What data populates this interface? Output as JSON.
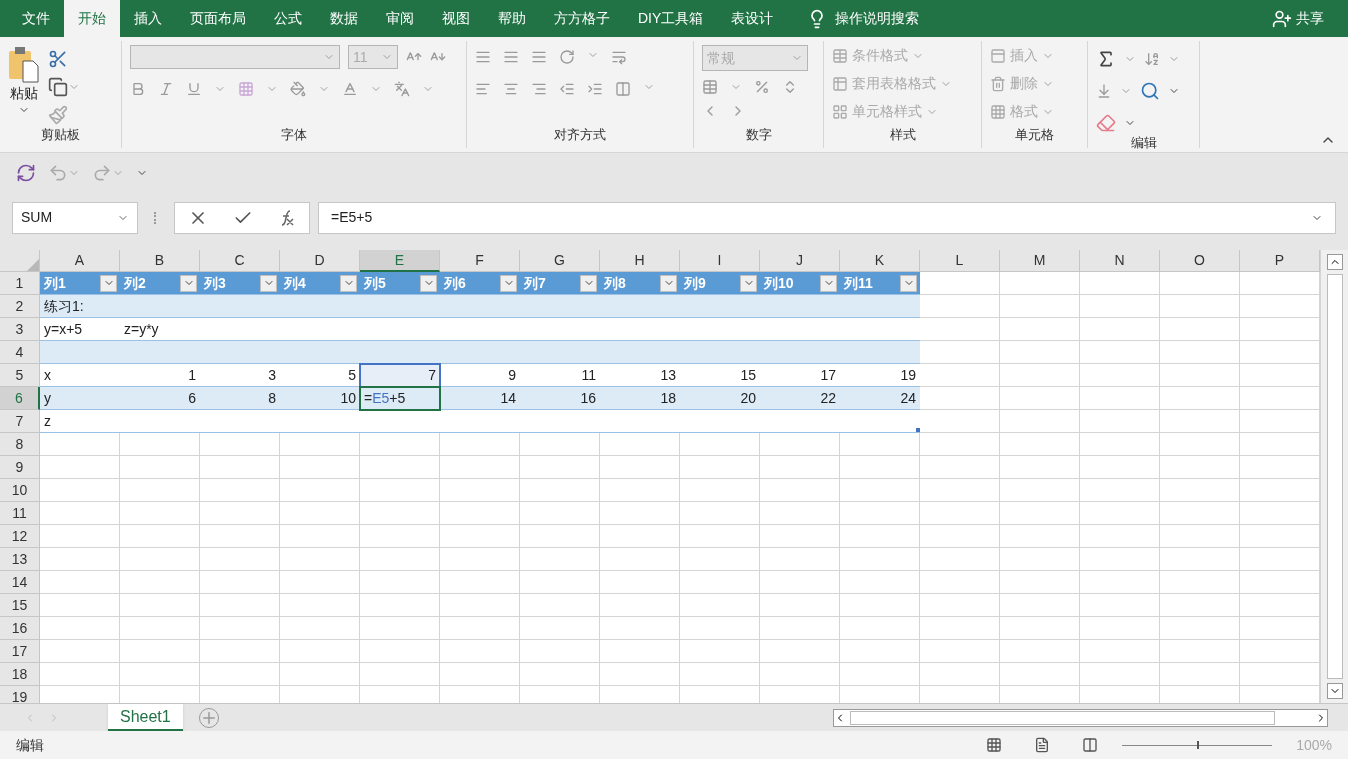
{
  "ribbon_tabs": [
    {
      "label": "文件",
      "selected": false
    },
    {
      "label": "开始",
      "selected": true
    },
    {
      "label": "插入",
      "selected": false
    },
    {
      "label": "页面布局",
      "selected": false
    },
    {
      "label": "公式",
      "selected": false
    },
    {
      "label": "数据",
      "selected": false
    },
    {
      "label": "审阅",
      "selected": false
    },
    {
      "label": "视图",
      "selected": false
    },
    {
      "label": "帮助",
      "selected": false
    },
    {
      "label": "方方格子",
      "selected": false
    },
    {
      "label": "DIY工具箱",
      "selected": false
    },
    {
      "label": "表设计",
      "selected": false
    }
  ],
  "tell_me": "操作说明搜索",
  "share": "共享",
  "ribbon": {
    "clipboard": {
      "label": "剪贴板",
      "paste": "粘贴"
    },
    "font": {
      "label": "字体",
      "size": "11"
    },
    "alignment": {
      "label": "对齐方式"
    },
    "number": {
      "label": "数字",
      "format": "常规"
    },
    "styles": {
      "label": "样式",
      "items": [
        "条件格式",
        "套用表格格式",
        "单元格样式"
      ]
    },
    "cells": {
      "label": "单元格",
      "items": [
        "插入",
        "删除",
        "格式"
      ]
    },
    "editing": {
      "label": "编辑"
    }
  },
  "formula_bar": {
    "name_box": "SUM",
    "formula": "=E5+5"
  },
  "sheet": {
    "columns": [
      {
        "label": "A",
        "selected": false
      },
      {
        "label": "B",
        "selected": false
      },
      {
        "label": "C",
        "selected": false
      },
      {
        "label": "D",
        "selected": false
      },
      {
        "label": "E",
        "selected": true
      },
      {
        "label": "F",
        "selected": false
      },
      {
        "label": "G",
        "selected": false
      },
      {
        "label": "H",
        "selected": false
      },
      {
        "label": "I",
        "selected": false
      },
      {
        "label": "J",
        "selected": false
      },
      {
        "label": "K",
        "selected": false
      },
      {
        "label": "L",
        "selected": false
      },
      {
        "label": "M",
        "selected": false
      },
      {
        "label": "N",
        "selected": false
      },
      {
        "label": "O",
        "selected": false
      },
      {
        "label": "P",
        "selected": false
      }
    ],
    "rows": [
      {
        "number": "1",
        "selected": false,
        "kind": "header",
        "cells": [
          {
            "text": "列1"
          },
          {
            "text": "列2"
          },
          {
            "text": "列3"
          },
          {
            "text": "列4"
          },
          {
            "text": "列5"
          },
          {
            "text": "列6"
          },
          {
            "text": "列7"
          },
          {
            "text": "列8"
          },
          {
            "text": "列9"
          },
          {
            "text": "列10"
          },
          {
            "text": "列11"
          }
        ]
      },
      {
        "number": "2",
        "selected": false,
        "kind": "band",
        "cells": [
          {
            "text": "练习1:",
            "kind": "text"
          }
        ]
      },
      {
        "number": "3",
        "selected": false,
        "kind": "table",
        "cells": [
          {
            "text": "y=x+5",
            "kind": "text"
          },
          {
            "text": "z=y*y",
            "kind": "text"
          }
        ]
      },
      {
        "number": "4",
        "selected": false,
        "kind": "band",
        "cells": []
      },
      {
        "number": "5",
        "selected": false,
        "kind": "table",
        "cells": [
          {
            "text": "x",
            "kind": "text",
            "referenced": false
          },
          {
            "text": "1",
            "kind": "number",
            "referenced": false
          },
          {
            "text": "3",
            "kind": "number",
            "referenced": false
          },
          {
            "text": "5",
            "kind": "number",
            "referenced": false
          },
          {
            "text": "7",
            "kind": "number",
            "referenced": true
          },
          {
            "text": "9",
            "kind": "number",
            "referenced": false
          },
          {
            "text": "11",
            "kind": "number",
            "referenced": false
          },
          {
            "text": "13",
            "kind": "number",
            "referenced": false
          },
          {
            "text": "15",
            "kind": "number",
            "referenced": false
          },
          {
            "text": "17",
            "kind": "number",
            "referenced": false
          },
          {
            "text": "19",
            "kind": "number",
            "referenced": false
          }
        ]
      },
      {
        "number": "6",
        "selected": true,
        "kind": "band",
        "cells": [
          {
            "text": "y",
            "kind": "text"
          },
          {
            "text": "6",
            "kind": "number"
          },
          {
            "text": "8",
            "kind": "number"
          },
          {
            "text": "10",
            "kind": "number"
          },
          {
            "kind": "formula",
            "parts": [
              {
                "text": "=",
                "kind": "plain"
              },
              {
                "text": "E5",
                "kind": "ref"
              },
              {
                "text": "+5",
                "kind": "plain"
              }
            ]
          },
          {
            "text": "14",
            "kind": "number"
          },
          {
            "text": "16",
            "kind": "number"
          },
          {
            "text": "18",
            "kind": "number"
          },
          {
            "text": "20",
            "kind": "number"
          },
          {
            "text": "22",
            "kind": "number"
          },
          {
            "text": "24",
            "kind": "number"
          }
        ]
      },
      {
        "number": "7",
        "selected": false,
        "kind": "table",
        "cells": [
          {
            "text": "z",
            "kind": "text"
          }
        ]
      },
      {
        "number": "8",
        "selected": false,
        "kind": "plain",
        "cells": []
      },
      {
        "number": "9",
        "selected": false,
        "kind": "plain",
        "cells": []
      },
      {
        "number": "10",
        "selected": false,
        "kind": "plain",
        "cells": []
      },
      {
        "number": "11",
        "selected": false,
        "kind": "plain",
        "cells": []
      },
      {
        "number": "12",
        "selected": false,
        "kind": "plain",
        "cells": []
      },
      {
        "number": "13",
        "selected": false,
        "kind": "plain",
        "cells": []
      },
      {
        "number": "14",
        "selected": false,
        "kind": "plain",
        "cells": []
      },
      {
        "number": "15",
        "selected": false,
        "kind": "plain",
        "cells": []
      },
      {
        "number": "16",
        "selected": false,
        "kind": "plain",
        "cells": []
      },
      {
        "number": "17",
        "selected": false,
        "kind": "plain",
        "cells": []
      },
      {
        "number": "18",
        "selected": false,
        "kind": "plain",
        "cells": []
      },
      {
        "number": "19",
        "selected": false,
        "kind": "plain",
        "cells": []
      }
    ]
  },
  "sheet_tabs": [
    {
      "label": "Sheet1",
      "selected": true
    }
  ],
  "status_bar": {
    "mode": "编辑",
    "zoom_slider": {
      "level": 0.5
    },
    "zoom": "100%"
  }
}
